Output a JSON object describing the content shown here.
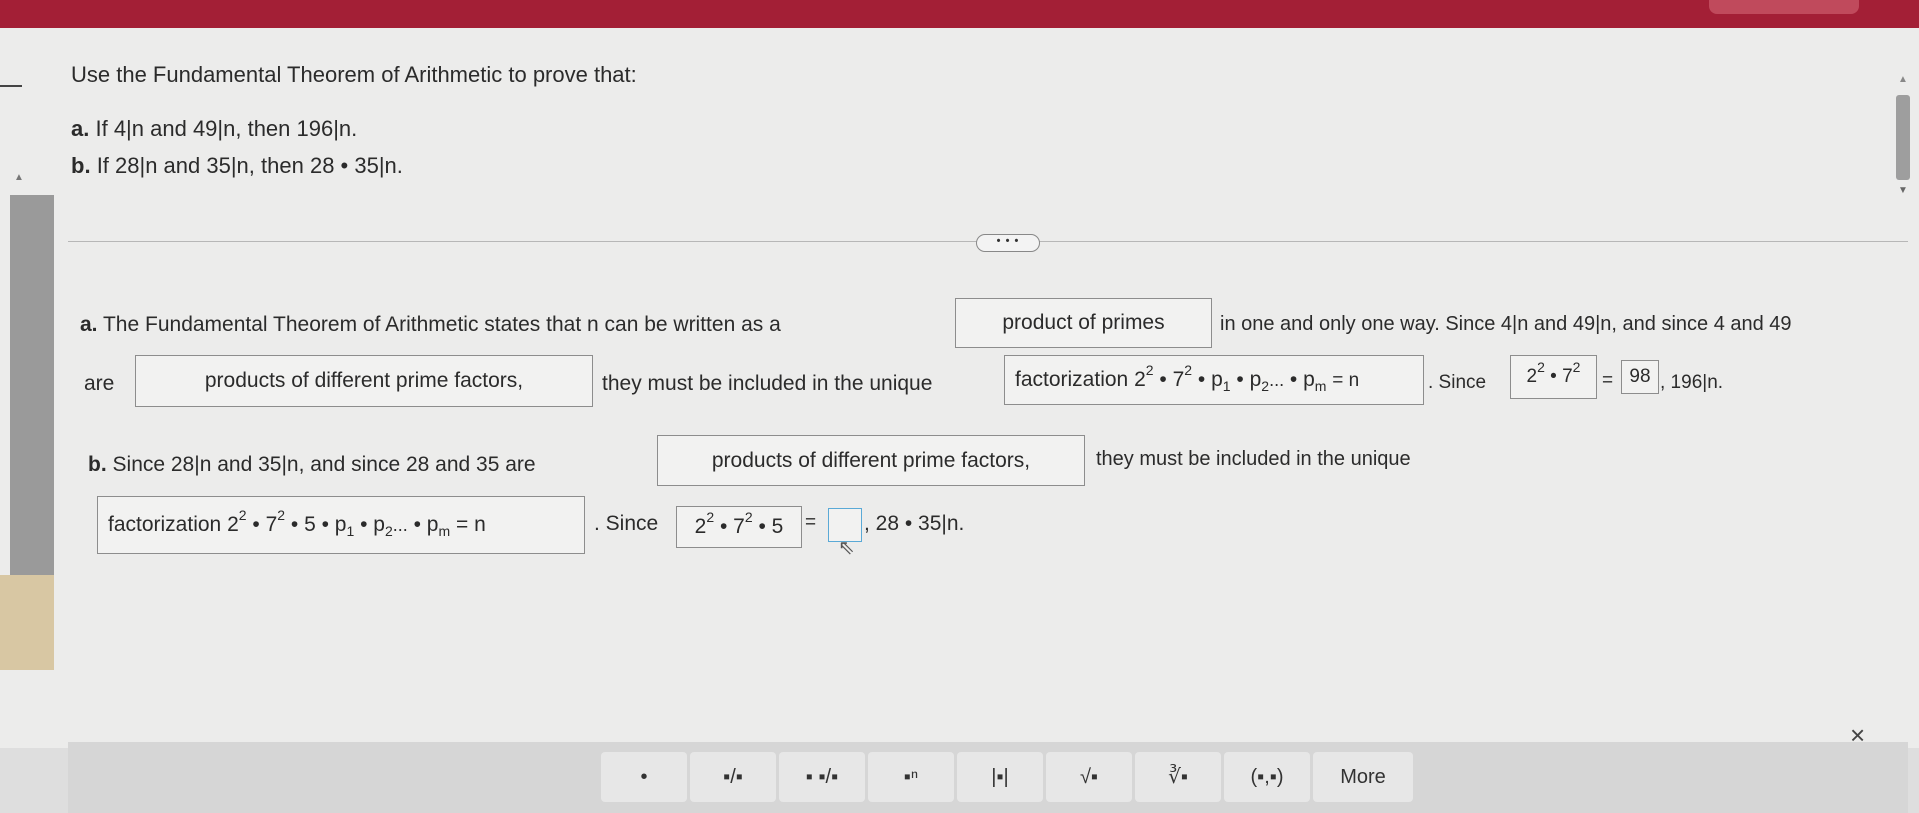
{
  "question": {
    "prompt": "Use the Fundamental Theorem of Arithmetic to prove that:",
    "part_a_label": "a.",
    "part_a_text": "If 4|n and 49|n, then 196|n.",
    "part_b_label": "b.",
    "part_b_text": "If 28|n and 35|n, then 28 • 35|n."
  },
  "expand_label": "• • •",
  "answer_a": {
    "label": "a.",
    "text1": "The Fundamental Theorem of Arithmetic states that n can be written as a",
    "dropdown1": "product of primes",
    "text2": "in one and only one way. Since 4|n and 49|n, and since 4 and 49",
    "text3": "are",
    "dropdown2": "products of different prime factors,",
    "text4": "they must be included in the unique",
    "dropdown3_word": "factorization",
    "text5": ". Since",
    "answer_value": "98",
    "text6": ", 196|n."
  },
  "answer_b": {
    "label": "b.",
    "text1": "Since 28|n and 35|n, and since 28 and 35 are",
    "dropdown1": "products of different prime factors,",
    "text2": "they must be included in the unique",
    "dropdown2_word": "factorization",
    "text3": ". Since",
    "answer_value": "",
    "text4": ", 28 • 35|n."
  },
  "palette": {
    "buttons": [
      "•",
      "▪/▪",
      "▪ ▪/▪",
      "▪ⁿ",
      "|▪|",
      "√▪",
      "∛▪",
      "(▪,▪)",
      "More"
    ],
    "close_label": "×"
  },
  "colors": {
    "topbar": "#a31f36",
    "paper": "#ececeb"
  }
}
